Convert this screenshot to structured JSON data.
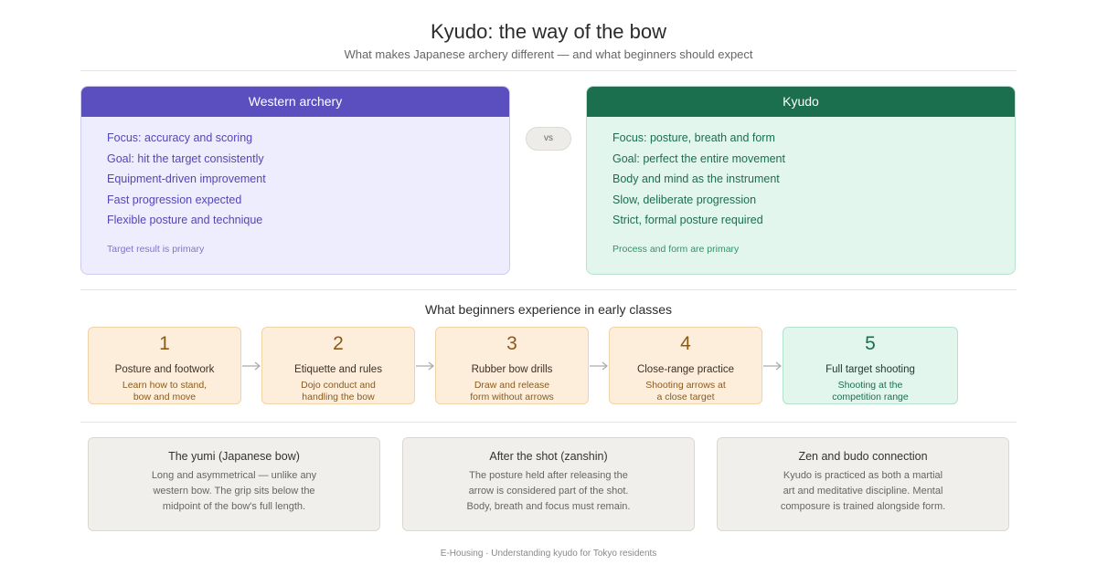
{
  "header": {
    "title": "Kyudo: the way of the bow",
    "subtitle": "What makes Japanese archery different — and what beginners should expect"
  },
  "comparison": {
    "western": {
      "title": "Western archery",
      "items": [
        "Focus: accuracy and scoring",
        "Goal: hit the target consistently",
        "Equipment-driven improvement",
        "Fast progression expected",
        "Flexible posture and technique"
      ],
      "note": "Target result is primary"
    },
    "vs_label": "vs",
    "kyudo": {
      "title": "Kyudo",
      "items": [
        "Focus: posture, breath and form",
        "Goal: perfect the entire movement",
        "Body and mind as the instrument",
        "Slow, deliberate progression",
        "Strict, formal posture required"
      ],
      "note": "Process and form are primary"
    }
  },
  "steps_section": {
    "title": "What beginners experience in early classes",
    "steps": [
      {
        "num": "1",
        "name": "Posture and footwork",
        "desc": "Learn how to stand,\nbow and move"
      },
      {
        "num": "2",
        "name": "Etiquette and rules",
        "desc": "Dojo conduct and\nhandling the bow"
      },
      {
        "num": "3",
        "name": "Rubber bow drills",
        "desc": "Draw and release\nform without arrows"
      },
      {
        "num": "4",
        "name": "Close-range practice",
        "desc": "Shooting arrows at\na close target"
      },
      {
        "num": "5",
        "name": "Full target shooting",
        "desc": "Shooting at the\ncompetition range"
      }
    ]
  },
  "info_cards": [
    {
      "title": "The yumi (Japanese bow)",
      "text": "Long and asymmetrical — unlike any\nwestern bow. The grip sits below the\nmidpoint of the bow's full length."
    },
    {
      "title": "After the shot (zanshin)",
      "text": "The posture held after releasing the\narrow is considered part of the shot.\nBody, breath and focus must remain."
    },
    {
      "title": "Zen and budo connection",
      "text": "Kyudo is practiced as both a martial\nart and meditative discipline. Mental\ncomposure is trained alongside form."
    }
  ],
  "footer": {
    "text": "E-Housing · Understanding kyudo for Tokyo residents"
  },
  "colors": {
    "western_accent": "#5b4fbf",
    "kyudo_accent": "#1b6e4e",
    "step_orange": "#fdeedc",
    "step_green": "#e3f6ee"
  }
}
